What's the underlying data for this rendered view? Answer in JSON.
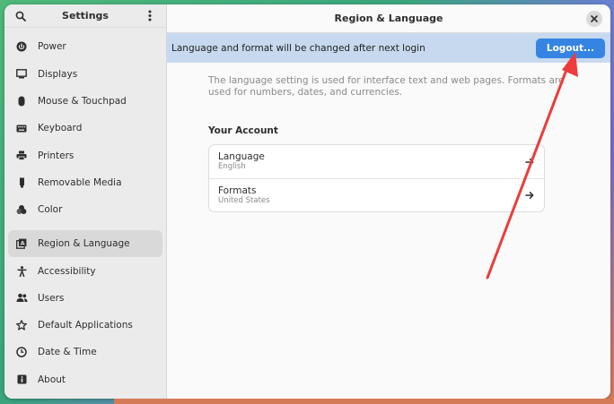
{
  "sidebar": {
    "title": "Settings",
    "items": [
      {
        "label": "Power",
        "icon": "power-icon"
      },
      {
        "label": "Displays",
        "icon": "display-icon"
      },
      {
        "label": "Mouse & Touchpad",
        "icon": "mouse-icon"
      },
      {
        "label": "Keyboard",
        "icon": "keyboard-icon"
      },
      {
        "label": "Printers",
        "icon": "printer-icon"
      },
      {
        "label": "Removable Media",
        "icon": "usb-icon"
      },
      {
        "label": "Color",
        "icon": "color-icon"
      },
      {
        "label": "Region & Language",
        "icon": "region-icon",
        "active": true
      },
      {
        "label": "Accessibility",
        "icon": "accessibility-icon"
      },
      {
        "label": "Users",
        "icon": "users-icon"
      },
      {
        "label": "Default Applications",
        "icon": "star-icon"
      },
      {
        "label": "Date & Time",
        "icon": "clock-icon"
      },
      {
        "label": "About",
        "icon": "info-icon"
      }
    ]
  },
  "main": {
    "title": "Region & Language",
    "banner": {
      "text": "Language and format will be changed after next login",
      "button": "Logout..."
    },
    "description": "The language setting is used for interface text and web pages. Formats are used for numbers, dates, and currencies.",
    "section_title": "Your Account",
    "rows": [
      {
        "title": "Language",
        "subtitle": "English"
      },
      {
        "title": "Formats",
        "subtitle": "United States"
      }
    ]
  },
  "colors": {
    "accent": "#3584e4",
    "banner": "#c6d9ee",
    "annotation": "#ee3b3b"
  }
}
